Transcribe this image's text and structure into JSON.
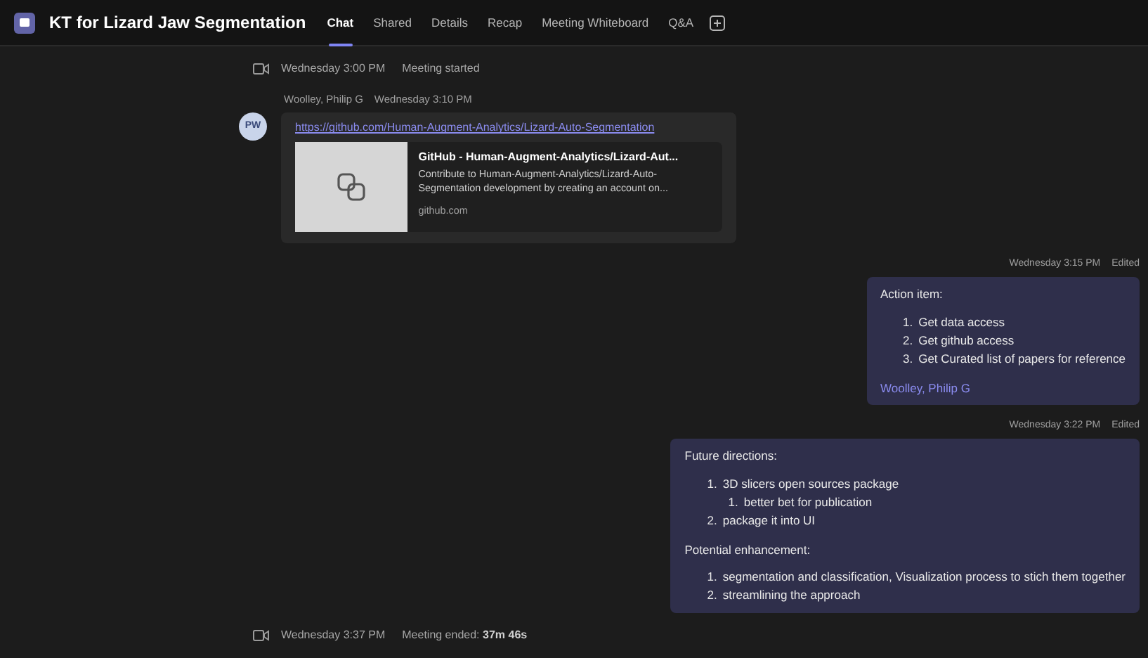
{
  "header": {
    "title": "KT for Lizard Jaw Segmentation",
    "tabs": [
      {
        "label": "Chat",
        "selected": true
      },
      {
        "label": "Shared",
        "selected": false
      },
      {
        "label": "Details",
        "selected": false
      },
      {
        "label": "Recap",
        "selected": false
      },
      {
        "label": "Meeting Whiteboard",
        "selected": false
      },
      {
        "label": "Q&A",
        "selected": false
      }
    ]
  },
  "messages": [
    {
      "kind": "event",
      "time": "Wednesday 3:00 PM",
      "text": "Meeting started"
    },
    {
      "kind": "incoming",
      "initials": "PW",
      "author": "Woolley, Philip G",
      "time": "Wednesday 3:10 PM",
      "link": "https://github.com/Human-Augment-Analytics/Lizard-Auto-Segmentation",
      "preview": {
        "title": "GitHub - Human-Augment-Analytics/Lizard-Aut...",
        "description": "Contribute to Human-Augment-Analytics/Lizard-Auto-Segmentation development by creating an account on...",
        "domain": "github.com"
      }
    },
    {
      "kind": "outgoing",
      "time": "Wednesday 3:15 PM",
      "edited": "Edited",
      "sections": [
        {
          "heading": "Action item:",
          "items": [
            {
              "number": "1.",
              "text": "Get data access"
            },
            {
              "number": "2.",
              "text": "Get github access"
            },
            {
              "number": "3.",
              "text": "Get Curated list of papers for reference"
            }
          ]
        }
      ],
      "mention": "Woolley, Philip G"
    },
    {
      "kind": "outgoing",
      "time": "Wednesday 3:22 PM",
      "edited": "Edited",
      "sections": [
        {
          "heading": "Future directions:",
          "items": [
            {
              "number": "1.",
              "text": "3D slicers open sources package",
              "children": [
                {
                  "number": "1.",
                  "text": "better bet for publication"
                }
              ]
            },
            {
              "number": "2.",
              "text": "package it into UI"
            }
          ]
        },
        {
          "heading": "Potential enhancement:",
          "items": [
            {
              "number": "1.",
              "text": "segmentation and classification, Visualization process to stich them together"
            },
            {
              "number": "2.",
              "text": "streamlining the approach"
            }
          ]
        }
      ]
    },
    {
      "kind": "event",
      "time": "Wednesday 3:37 PM",
      "text": "Meeting ended:",
      "duration": "37m 46s"
    }
  ]
}
